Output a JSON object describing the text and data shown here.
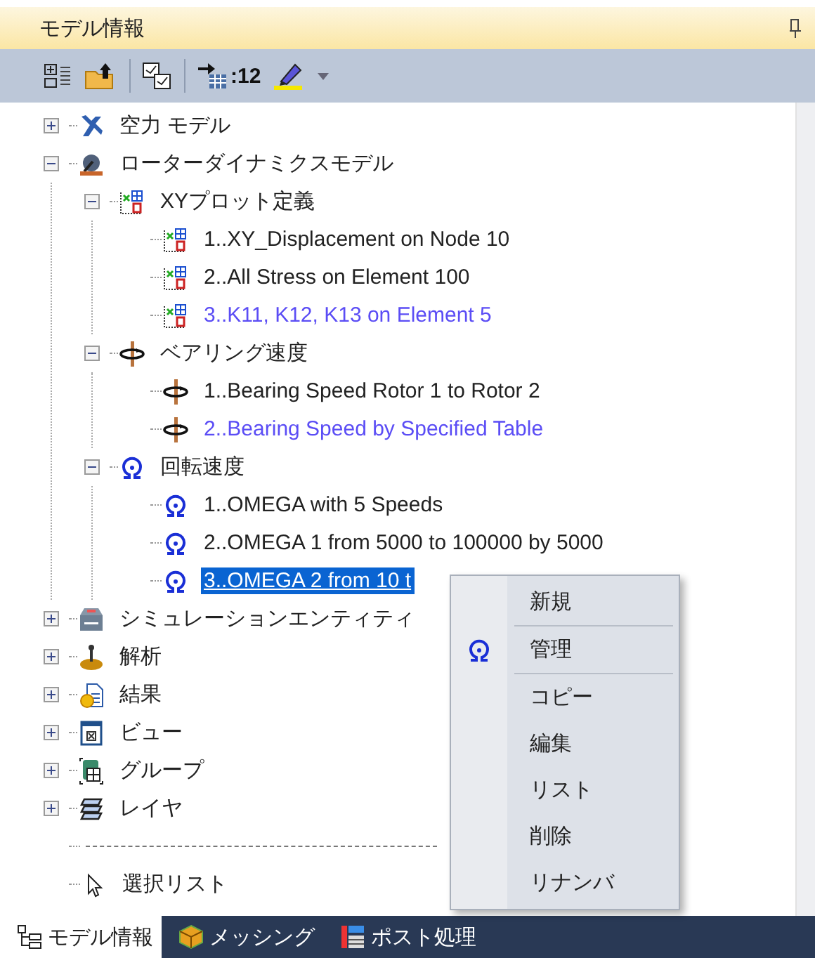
{
  "panel": {
    "title": "モデル情報"
  },
  "toolbar": {
    "count": ":12"
  },
  "tree": [
    {
      "label": "空力 モデル",
      "kind": "aero",
      "expanded": false,
      "current": false,
      "selected": false
    },
    {
      "label": "ローターダイナミクスモデル",
      "kind": "rotor",
      "expanded": true,
      "current": false,
      "selected": false,
      "children": [
        {
          "label": "XYプロット定義",
          "kind": "xyplot",
          "expanded": true,
          "current": false,
          "selected": false,
          "children": [
            {
              "label": "1..XY_Displacement on Node 10",
              "kind": "xyplot",
              "current": false,
              "selected": false
            },
            {
              "label": "2..All Stress on Element 100",
              "kind": "xyplot",
              "current": false,
              "selected": false
            },
            {
              "label": "3..K11, K12, K13 on Element 5",
              "kind": "xyplot",
              "current": true,
              "selected": false
            }
          ]
        },
        {
          "label": "ベアリング速度",
          "kind": "bearing",
          "expanded": true,
          "current": false,
          "selected": false,
          "children": [
            {
              "label": "1..Bearing Speed Rotor 1 to Rotor 2",
              "kind": "bearing",
              "current": false,
              "selected": false
            },
            {
              "label": "2..Bearing Speed by Specified Table",
              "kind": "bearing",
              "current": true,
              "selected": false
            }
          ]
        },
        {
          "label": "回転速度",
          "kind": "omega",
          "expanded": true,
          "current": false,
          "selected": false,
          "children": [
            {
              "label": "1..OMEGA with 5 Speeds",
              "kind": "omega",
              "current": false,
              "selected": false
            },
            {
              "label": "2..OMEGA 1 from 5000 to 100000 by 5000",
              "kind": "omega",
              "current": false,
              "selected": false
            },
            {
              "label": "3..OMEGA 2 from 10 t",
              "kind": "omega",
              "current": false,
              "selected": true
            }
          ]
        }
      ]
    },
    {
      "label": "シミュレーションエンティティ",
      "kind": "sim",
      "expanded": false,
      "current": false,
      "selected": false
    },
    {
      "label": "解析",
      "kind": "analysis",
      "expanded": false,
      "current": false,
      "selected": false
    },
    {
      "label": "結果",
      "kind": "results",
      "expanded": false,
      "current": false,
      "selected": false
    },
    {
      "label": "ビュー",
      "kind": "view",
      "expanded": false,
      "current": false,
      "selected": false
    },
    {
      "label": "グループ",
      "kind": "group",
      "expanded": false,
      "current": false,
      "selected": false
    },
    {
      "label": "レイヤ",
      "kind": "layer",
      "expanded": false,
      "current": false,
      "selected": false
    },
    {
      "kind": "separator"
    },
    {
      "label": "選択リスト",
      "kind": "select",
      "current": false,
      "selected": false
    }
  ],
  "context_menu": [
    {
      "label": "新規",
      "marked": false,
      "separator_after": true
    },
    {
      "label": "管理",
      "marked": true,
      "separator_after": true
    },
    {
      "label": "コピー",
      "marked": false,
      "separator_after": false
    },
    {
      "label": "編集",
      "marked": false,
      "separator_after": false
    },
    {
      "label": "リスト",
      "marked": false,
      "separator_after": false
    },
    {
      "label": "削除",
      "marked": false,
      "separator_after": false
    },
    {
      "label": "リナンバ",
      "marked": false,
      "separator_after": false
    }
  ],
  "bottom_tabs": [
    {
      "label": "モデル情報",
      "selected": true
    },
    {
      "label": "メッシング",
      "selected": false
    },
    {
      "label": "ポスト処理",
      "selected": false
    }
  ]
}
